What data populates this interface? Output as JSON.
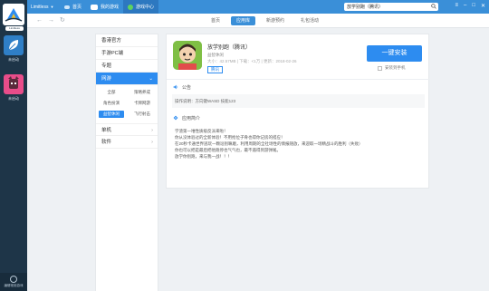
{
  "topbar": {
    "brand": "Limitless",
    "buttons": [
      {
        "label": "首页",
        "active": false
      },
      {
        "label": "我的游戏",
        "active": false
      },
      {
        "label": "游戏中心",
        "active": true
      }
    ],
    "search_value": "放学别跑（腾讯）",
    "colors": {
      "bar": "#3a8fd8",
      "accent": "#2d8cf0"
    }
  },
  "sidebar": {
    "user_badge": "Limitless",
    "slots": [
      {
        "label": "未启动",
        "icon": "leaf-icon"
      },
      {
        "label": "未启动",
        "icon": "game-character-icon"
      }
    ],
    "bottom_label": "编辑常用游戏"
  },
  "nav": {
    "tabs": [
      "首页",
      "应用库",
      "新游预约",
      "礼包活动"
    ],
    "active_tab": "应用库"
  },
  "categories": {
    "items_top": [
      "香港官方",
      "手游PC端",
      "专题"
    ],
    "active": "网游",
    "subs": [
      "全部",
      "策略养成",
      "角色扮演",
      "卡牌网游",
      "益智休闲",
      "飞行射击"
    ],
    "active_sub": "益智休闲",
    "items_bottom": [
      "单机",
      "软件"
    ]
  },
  "game": {
    "title": "放学别跑（腾讯）",
    "category": "益智休闲",
    "meta": "大小：42.57MB | 下载：<1万 | 更新：2018-02-26",
    "tag": "腾讯",
    "install_label": "一键安装",
    "install_option": "安装到手机"
  },
  "notice": {
    "heading": "公告",
    "body": "操作说明：方向键WASD 技能123"
  },
  "intro": {
    "heading": "应用简介",
    "lines": [
      "学渣第一堆性质级反派来啦！",
      "你从没体验过的全新体验！不用抢位子骨也得你记房的搭应！",
      "在20秒卡通世界逃玩一颗逗别嘛磨，利用周期的全社场性的情报随放，来迎取一场精战斗的胜利（失败）",
      "你也可以把是最后把他跑停也气气也，最不遏得到游弹尾。",
      "放学你别跑，来与我一战！！！"
    ]
  }
}
